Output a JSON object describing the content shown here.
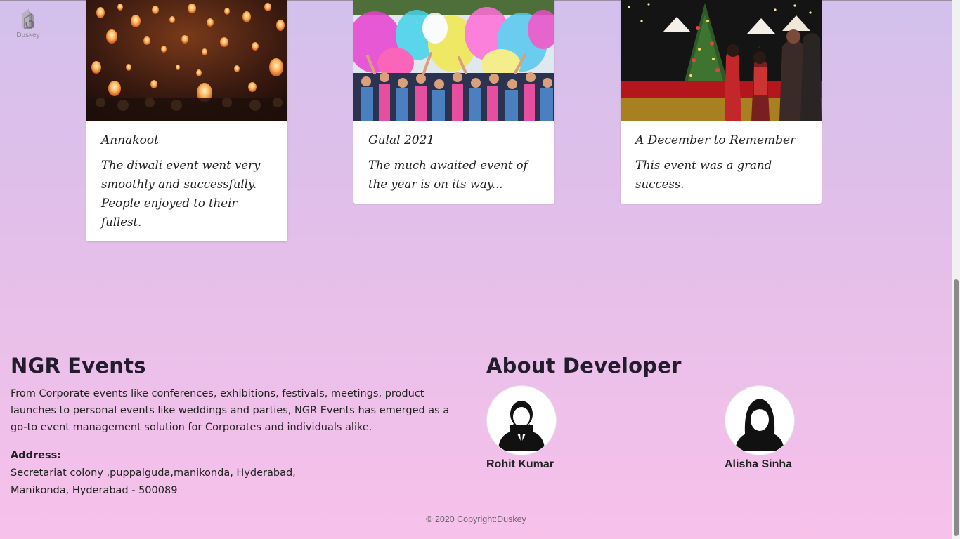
{
  "logo": {
    "text": "Duskey"
  },
  "cards": [
    {
      "title": "Annakoot",
      "text": "The diwali event went very smoothly and successfully. People enjoyed to their fullest."
    },
    {
      "title": "Gulal 2021",
      "text": "The much awaited event of the year is on its way..."
    },
    {
      "title": "A December to Remember",
      "text": "This event was a grand success."
    }
  ],
  "footer": {
    "about_heading": "NGR Events",
    "about_text": "From Corporate events like conferences, exhibitions, festivals, meetings, product launches to personal events like weddings and parties, NGR Events has emerged as a go-to event management solution for Corporates and individuals alike.",
    "address_label": "Address:",
    "address_line1": "Secretariat colony ,puppalguda,manikonda, Hyderabad,",
    "address_line2": "Manikonda, Hyderabad - 500089",
    "developer_heading": "About Developer",
    "developers": [
      {
        "name": "Rohit Kumar",
        "icon": "male-avatar-icon"
      },
      {
        "name": "Alisha Sinha",
        "icon": "female-avatar-icon"
      }
    ],
    "copyright": "© 2020 Copyright:Duskey"
  }
}
